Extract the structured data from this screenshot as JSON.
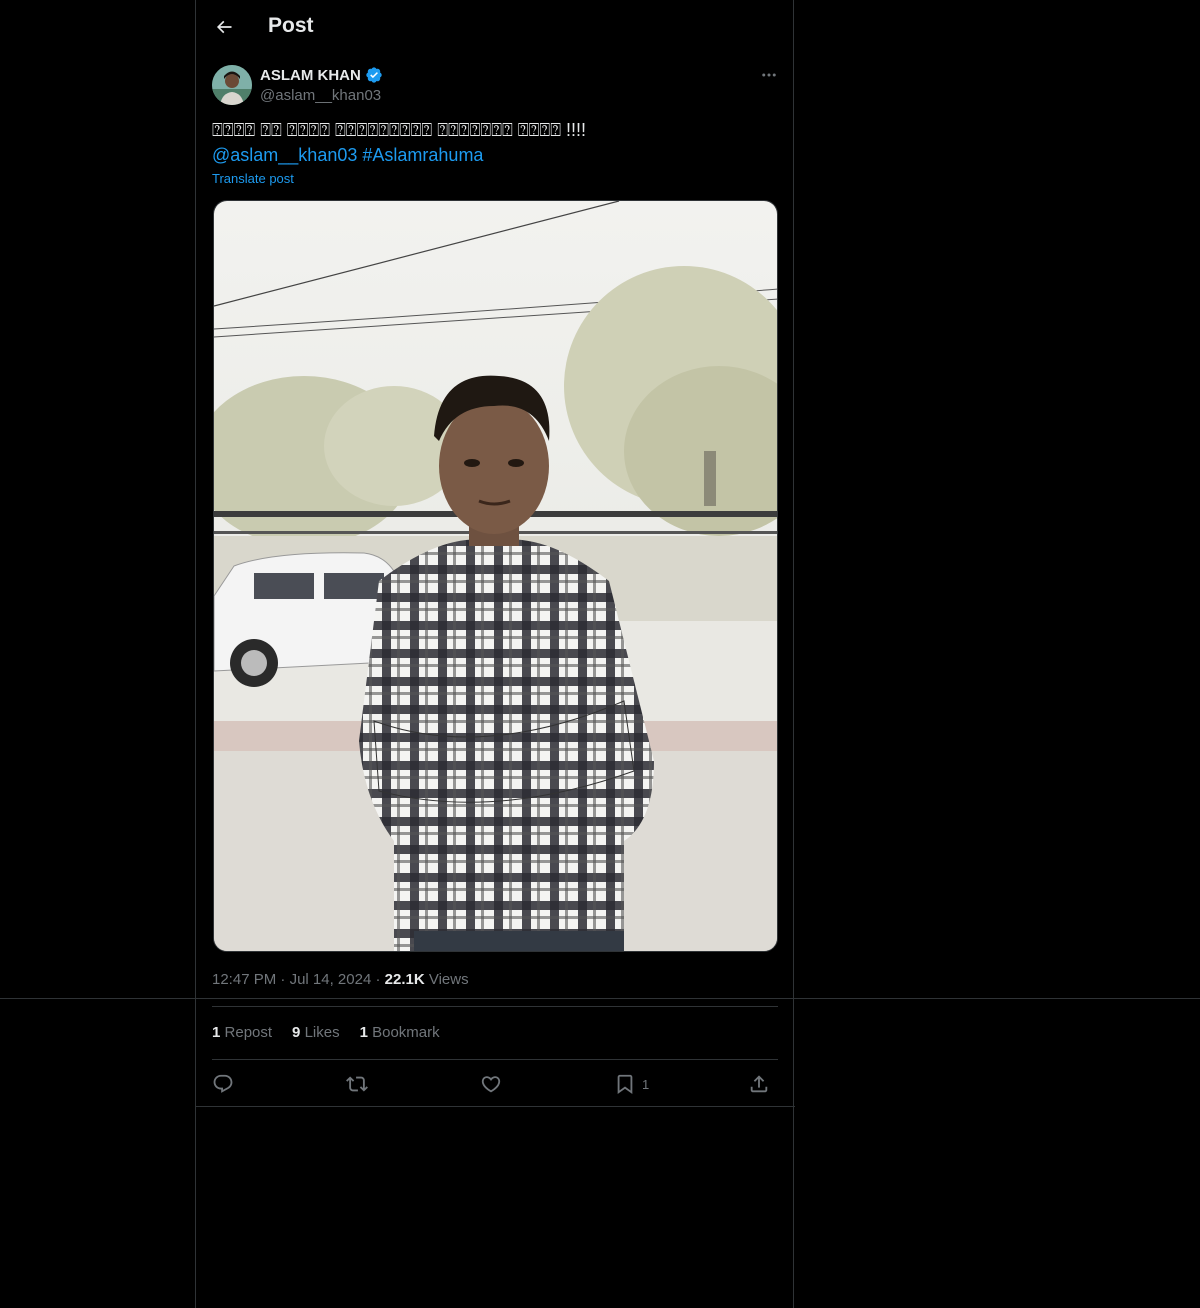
{
  "header": {
    "title": "Post"
  },
  "post": {
    "author_name": "ASLAM KHAN",
    "author_handle": "@aslam__khan03",
    "text": "⍰⍰⍰⍰ ⍰⍰ ⍰⍰⍰⍰ ⍰⍰⍰⍰⍰⍰⍰⍰⍰ ⍰⍰⍰⍰⍰⍰⍰ ⍰⍰⍰⍰ !!!!",
    "mention": "@aslam__khan03",
    "hashtag": "#Aslamrahuma",
    "translate_label": "Translate post",
    "time": "12:47 PM",
    "date": "Jul 14, 2024",
    "views_count": "22.1K",
    "views_label": "Views"
  },
  "stats": {
    "reposts_count": "1",
    "reposts_label": "Repost",
    "likes_count": "9",
    "likes_label": "Likes",
    "bookmarks_count": "1",
    "bookmarks_label": "Bookmark"
  },
  "actions": {
    "bookmark_count": "1",
    "icons": [
      "reply-icon",
      "repost-icon",
      "like-icon",
      "bookmark-icon",
      "share-icon"
    ]
  },
  "colors": {
    "background": "#000000",
    "text": "#e7e9ea",
    "muted": "#71767b",
    "accent": "#1d9bf0",
    "border": "#2f3336"
  }
}
